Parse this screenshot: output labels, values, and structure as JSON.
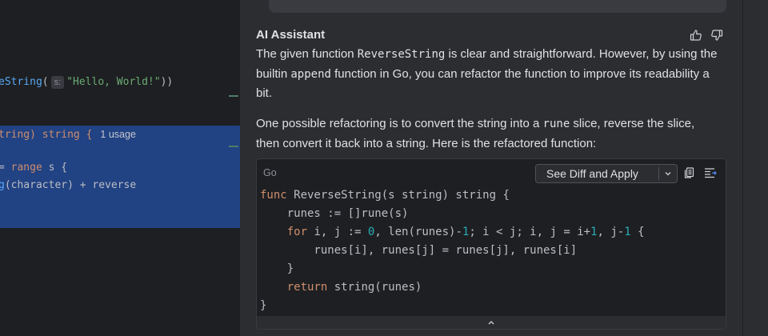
{
  "editor": {
    "call_line": {
      "fn_tail": "eString",
      "open": "(",
      "hint": "s:",
      "arg": "\"Hello, World!\"",
      "close": "))"
    },
    "sig_line": {
      "tail": "tring)",
      "ret": " string {",
      "usage": "1 usage"
    },
    "range_line": {
      "pre": "= ",
      "kw": "range",
      "post": " s {"
    },
    "concat_line": {
      "fn_tail": "g",
      "rest": "(character) + reverse"
    }
  },
  "assistant": {
    "title": "AI Assistant",
    "p1_a": "The given function ",
    "p1_code": "ReverseString",
    "p1_b": " is clear and straightforward. However, by using the builtin ",
    "p1_code2": "append",
    "p1_c": " function in Go, you can refactor the function to improve its readability a bit.",
    "p2_a": "One possible refactoring is to convert the string into a ",
    "p2_code": "rune",
    "p2_b": " slice, reverse the slice, then convert it back into a string. Here is the refactored function:"
  },
  "code_block": {
    "language": "Go",
    "diff_button": "See Diff and Apply",
    "lines": {
      "l1_kw": "func",
      "l1_rest": " ReverseString(s string) string {",
      "l2": "    runes := []rune(s)",
      "l3_kw": "    for",
      "l3_a": " i, j := ",
      "l3_n0": "0",
      "l3_b": ", len(runes)-",
      "l3_n1": "1",
      "l3_c": "; i < j; i, j = i+",
      "l3_n2": "1",
      "l3_d": ", j-",
      "l3_n3": "1",
      "l3_e": " {",
      "l4": "        runes[i], runes[j] = runes[j], runes[i]",
      "l5": "    }",
      "l6_kw": "    return",
      "l6_rest": " string(runes)",
      "l7": "}"
    }
  },
  "icons": {
    "thumb_up": "thumbs-up-icon",
    "thumb_down": "thumbs-down-icon",
    "copy": "copy-icon",
    "insert": "insert-at-caret-icon",
    "chevron": "chevron-down-icon",
    "collapse": "chevron-up-icon"
  },
  "colors": {
    "selection": "#214283",
    "keyword": "#cf8e6d",
    "string": "#6aab73",
    "function": "#56a8f5",
    "number": "#2aacb8"
  }
}
